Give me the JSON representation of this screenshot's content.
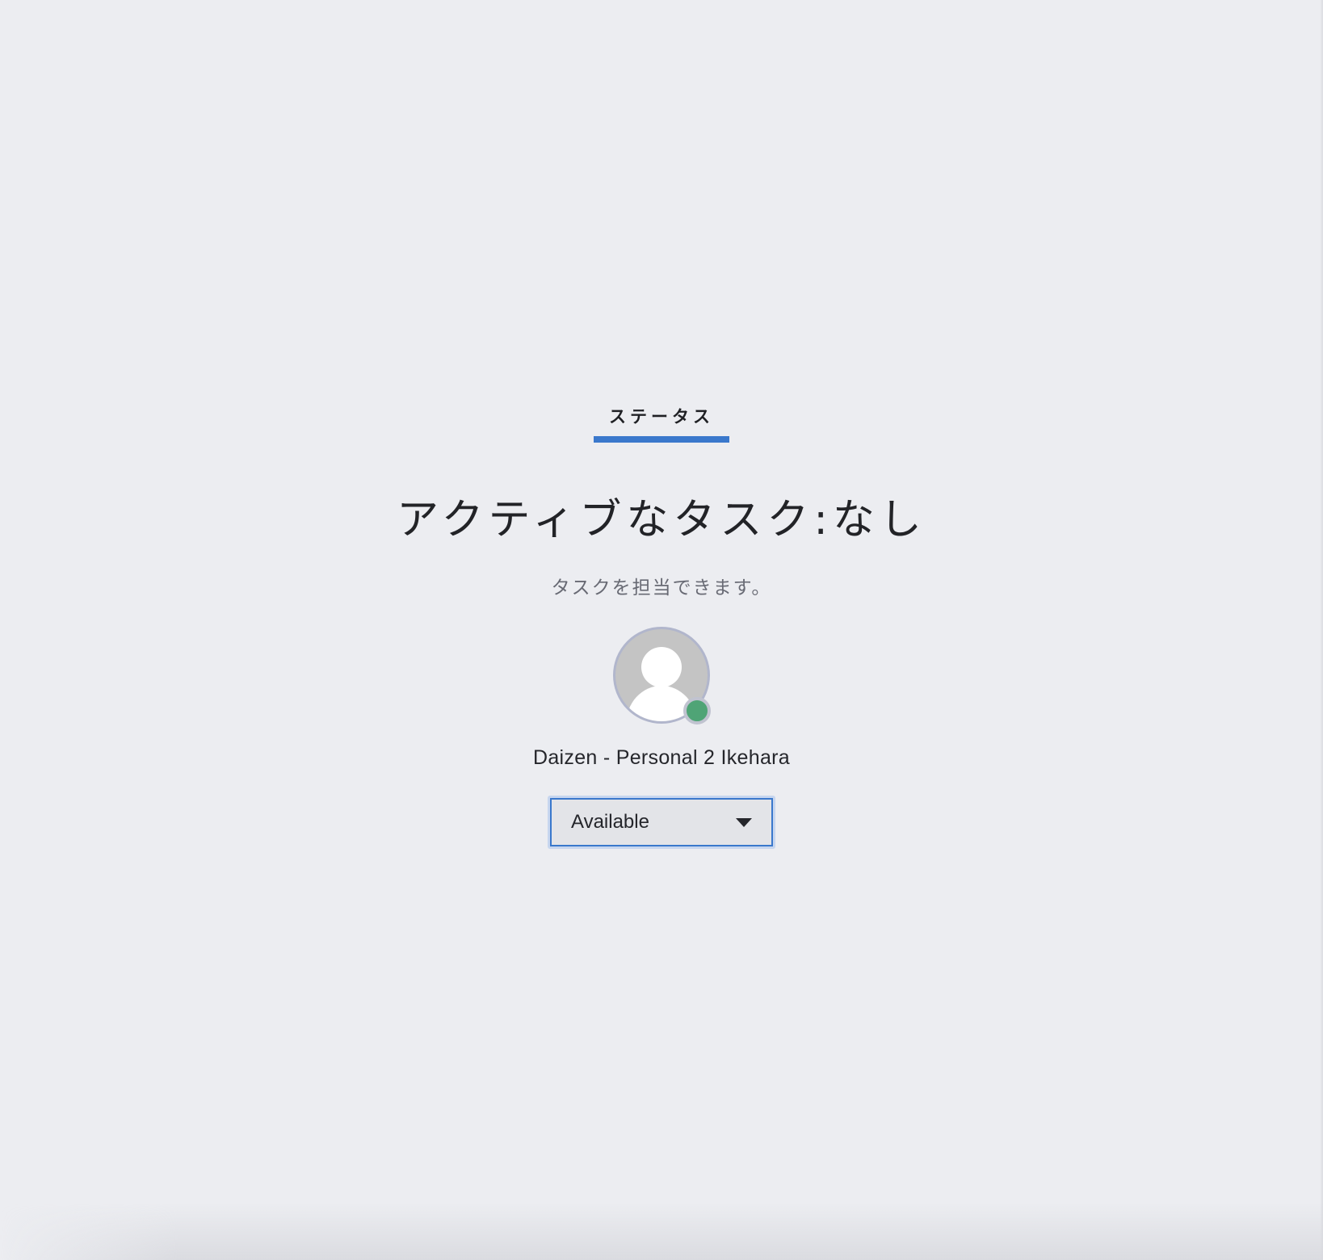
{
  "tab": {
    "label": "ステータス"
  },
  "status": {
    "title": "アクティブなタスク:なし",
    "subtitle": "タスクを担当できます。"
  },
  "user": {
    "name": "Daizen - Personal 2 Ikehara",
    "presence": "available",
    "presence_color": "#4fa476",
    "avatar_icon": "default-user-avatar"
  },
  "availability_select": {
    "value": "Available",
    "icon": "caret-down-icon"
  },
  "colors": {
    "accent": "#3a78cc",
    "background": "#ecedf1"
  }
}
